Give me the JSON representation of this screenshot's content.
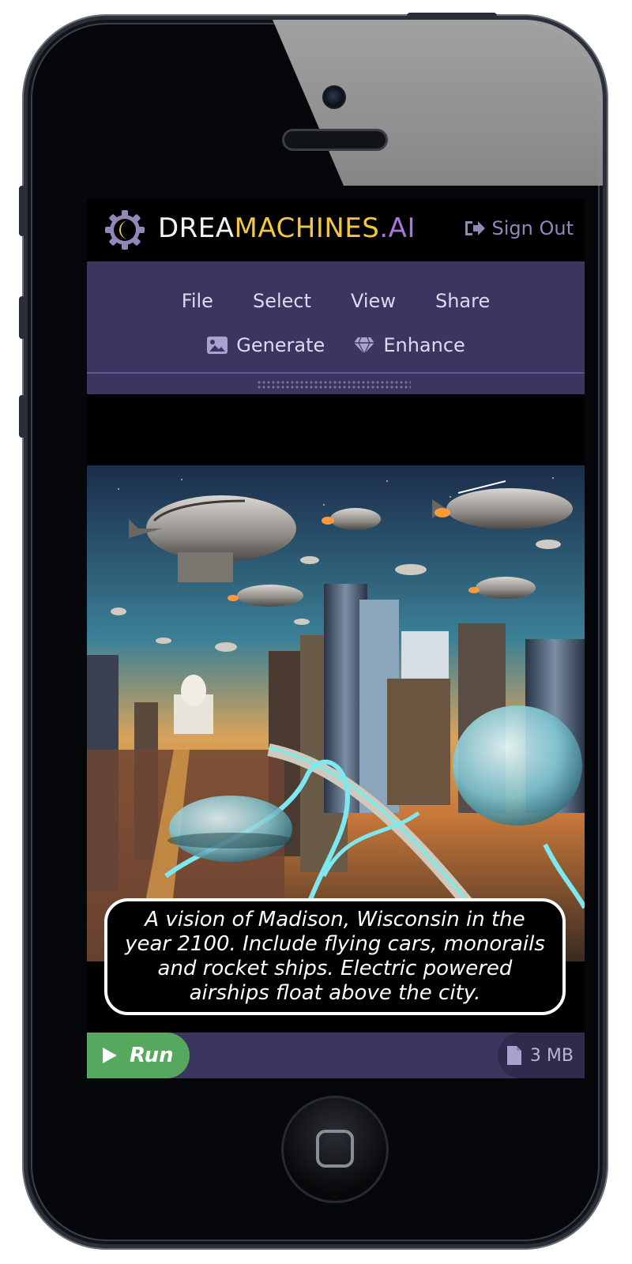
{
  "brand": {
    "part1": "DREA",
    "part2": "MACHINES",
    "part3": ".AI",
    "colors": {
      "white": "#f3f3f3",
      "gold": "#f0c840",
      "purple": "#a876d6"
    }
  },
  "header": {
    "signout_label": "Sign Out",
    "signout_icon": "sign-out-icon"
  },
  "menu": {
    "row1": [
      "File",
      "Select",
      "View",
      "Share"
    ],
    "generate_label": "Generate",
    "generate_icon": "image-icon",
    "enhance_label": "Enhance",
    "enhance_icon": "diamond-icon",
    "background": "#3b3660"
  },
  "prompt": {
    "text": "A vision of Madison, Wisconsin in the year 2100. Include flying cars, monorails and rocket ships. Electric powered airships float above the city."
  },
  "footer": {
    "run_label": "Run",
    "run_icon": "play-icon",
    "run_color": "#56a85e",
    "size_label": "3 MB",
    "size_icon": "file-icon"
  }
}
